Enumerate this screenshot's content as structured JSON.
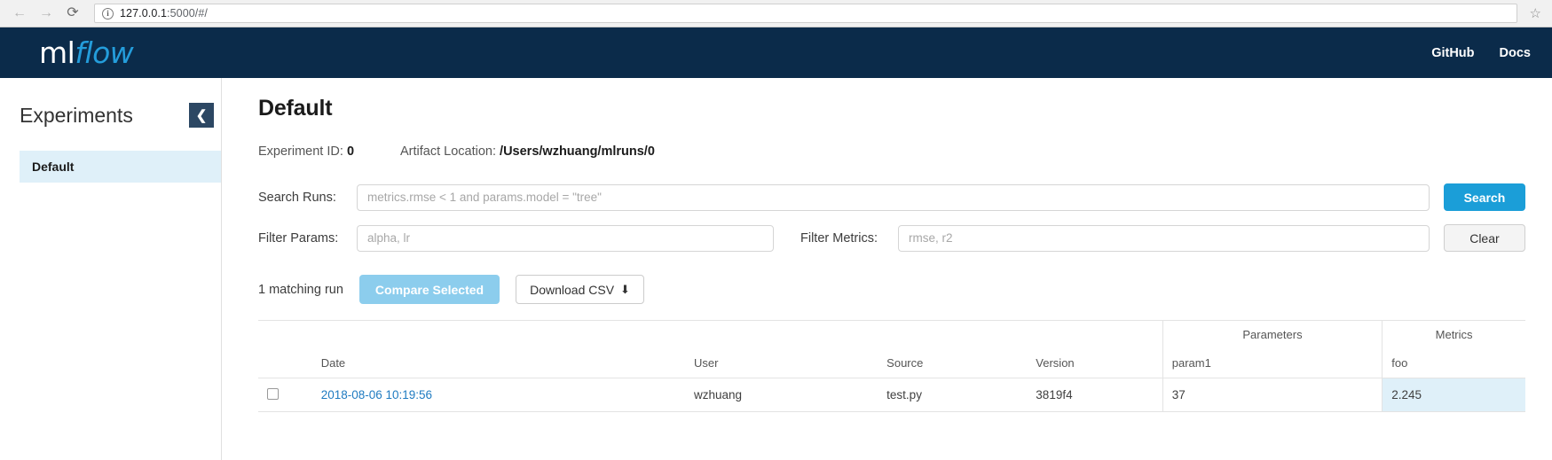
{
  "browser": {
    "back_icon": "←",
    "forward_icon": "→",
    "reload_icon": "⟳",
    "info_icon": "i",
    "url_host": "127.0.0.1",
    "url_rest": ":5000/#/",
    "star_icon": "☆"
  },
  "header": {
    "logo_ml": "ml",
    "logo_flow": "flow",
    "links": [
      {
        "label": "GitHub"
      },
      {
        "label": "Docs"
      }
    ]
  },
  "sidebar": {
    "title": "Experiments",
    "collapse_icon": "❮",
    "items": [
      {
        "label": "Default"
      }
    ]
  },
  "main": {
    "page_title": "Default",
    "meta": {
      "experiment_id_label": "Experiment ID:",
      "experiment_id_value": "0",
      "artifact_label": "Artifact Location:",
      "artifact_value": "/Users/wzhuang/mlruns/0"
    },
    "search": {
      "runs_label": "Search Runs:",
      "runs_placeholder": "metrics.rmse < 1 and params.model = \"tree\"",
      "runs_value": "",
      "search_button": "Search",
      "params_label": "Filter Params:",
      "params_placeholder": "alpha, lr",
      "params_value": "",
      "metrics_label": "Filter Metrics:",
      "metrics_placeholder": "rmse, r2",
      "metrics_value": "",
      "clear_button": "Clear"
    },
    "actions": {
      "match_count": "1 matching run",
      "compare_button": "Compare Selected",
      "download_button": "Download CSV",
      "download_icon": "⬇"
    },
    "table": {
      "group_headers": {
        "parameters": "Parameters",
        "metrics": "Metrics"
      },
      "columns": {
        "date": "Date",
        "user": "User",
        "source": "Source",
        "version": "Version",
        "param1": "param1",
        "foo": "foo"
      },
      "rows": [
        {
          "date": "2018-08-06 10:19:56",
          "user": "wzhuang",
          "source": "test.py",
          "version": "3819f4",
          "param1": "37",
          "foo": "2.245"
        }
      ]
    }
  },
  "colors": {
    "header_bg": "#0b2b4a",
    "logo_accent": "#249ddb",
    "primary_button": "#1b9ed8",
    "compare_button": "#8ccded",
    "highlight": "#dff0f9",
    "link": "#1f7bc1"
  }
}
